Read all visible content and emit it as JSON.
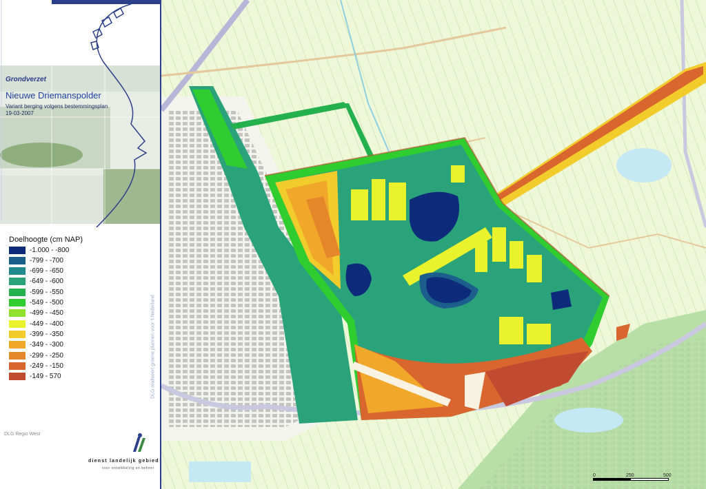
{
  "header": {
    "subtitle": "Grondverzet",
    "title": "Nieuwe Driemanspolder",
    "description": "Variant berging volgens bestemmingsplan",
    "date": "19-03-2007"
  },
  "legend": {
    "title": "Doelhoogte (cm NAP)",
    "items": [
      {
        "label": "-1.000 - -800",
        "color": "#0d2b7a"
      },
      {
        "label": "-799 - -700",
        "color": "#1b5e8c"
      },
      {
        "label": "-699 - -650",
        "color": "#1e8a8e"
      },
      {
        "label": "-649 - -600",
        "color": "#2aa37a"
      },
      {
        "label": "-599 - -550",
        "color": "#25b04e"
      },
      {
        "label": "-549 - -500",
        "color": "#2fcd2f"
      },
      {
        "label": "-499 - -450",
        "color": "#8fe02a"
      },
      {
        "label": "-449 - -400",
        "color": "#e9f22a"
      },
      {
        "label": "-399 - -350",
        "color": "#f2cc2a"
      },
      {
        "label": "-349 - -300",
        "color": "#f0a72a"
      },
      {
        "label": "-299 - -250",
        "color": "#e6862a"
      },
      {
        "label": "-249 - -150",
        "color": "#d9662e"
      },
      {
        "label": "-149 - 570",
        "color": "#c04b30"
      }
    ]
  },
  "vertical_note": "DLG realiseert groene plannen voor 't Nederland",
  "region_label": "DLG Regio West",
  "org": {
    "name": "dienst landelijk gebied",
    "tagline": "voor ontwikkeling en beheer"
  },
  "scale": {
    "labels": [
      "0",
      "250",
      "500"
    ]
  }
}
